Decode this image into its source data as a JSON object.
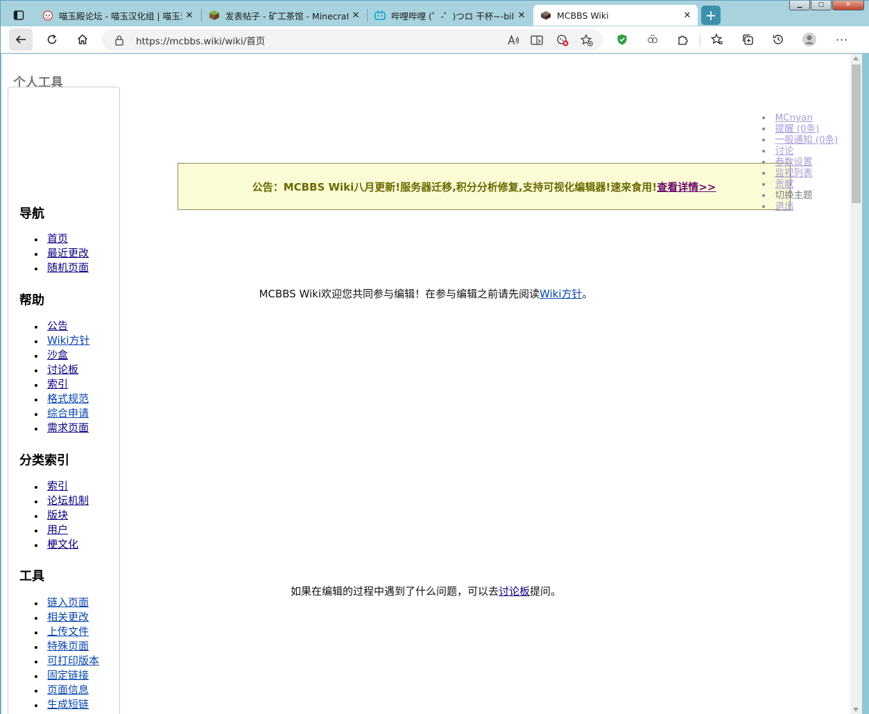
{
  "browser": {
    "tabs": [
      {
        "title": "喵玉殿论坛 - 喵玉汉化组 | 喵玉汉化",
        "favicon": "cat-face-icon",
        "active": false
      },
      {
        "title": "发表帖子 - 矿工茶馆 - Minecraft(我",
        "favicon": "minecraft-block-icon",
        "active": false
      },
      {
        "title": "哔哩哔哩 (゜-゜)つロ 干杯~-bilibili",
        "favicon": "bilibili-tv-icon",
        "active": false
      },
      {
        "title": "MCBBS Wiki",
        "favicon": "mcbbs-wiki-icon",
        "active": true
      }
    ],
    "new_tab_label": "+",
    "url": "https://mcbbs.wiki/wiki/首页",
    "accent": "#3e91ab"
  },
  "page": {
    "personal_tools_heading": "个人工具",
    "personal_tools": [
      {
        "label": "MCnyan",
        "link": true
      },
      {
        "label": "提醒 (0条)",
        "link": true
      },
      {
        "label": "一般通知 (0条)",
        "link": true
      },
      {
        "label": "讨论",
        "link": true
      },
      {
        "label": "参数设置",
        "link": true
      },
      {
        "label": "监视列表",
        "link": true
      },
      {
        "label": "贡献",
        "link": true
      },
      {
        "label": "切换主题",
        "link": false
      },
      {
        "label": "退出",
        "link": true
      }
    ],
    "sections": [
      {
        "heading": "导航",
        "items": [
          "首页",
          "最近更改",
          "随机页面"
        ]
      },
      {
        "heading": "帮助",
        "items": [
          "公告",
          "Wiki方针",
          "沙盒",
          "讨论板",
          "索引",
          "格式规范",
          "综合申请",
          "需求页面"
        ]
      },
      {
        "heading": "分类索引",
        "items": [
          "索引",
          "论坛机制",
          "版块",
          "用户",
          "梗文化"
        ]
      },
      {
        "heading": "工具",
        "items": [
          "链入页面",
          "相关更改",
          "上传文件",
          "特殊页面",
          "可打印版本",
          "固定链接",
          "页面信息",
          "生成短链"
        ]
      }
    ],
    "notice": {
      "text": "公告：MCBBS Wiki八月更新!服务器迁移,积分分析修复,支持可视化编辑器!速来食用!",
      "more_link": "查看详情>>"
    },
    "welcome": {
      "prefix": "MCBBS Wiki欢迎您共同参与编辑！在参与编辑之前请先阅读",
      "link": "Wiki方针",
      "suffix": "。"
    },
    "question": {
      "prefix": "如果在编辑的过程中遇到了什么问题，可以去",
      "link": "讨论板",
      "suffix": "提问。"
    }
  }
}
